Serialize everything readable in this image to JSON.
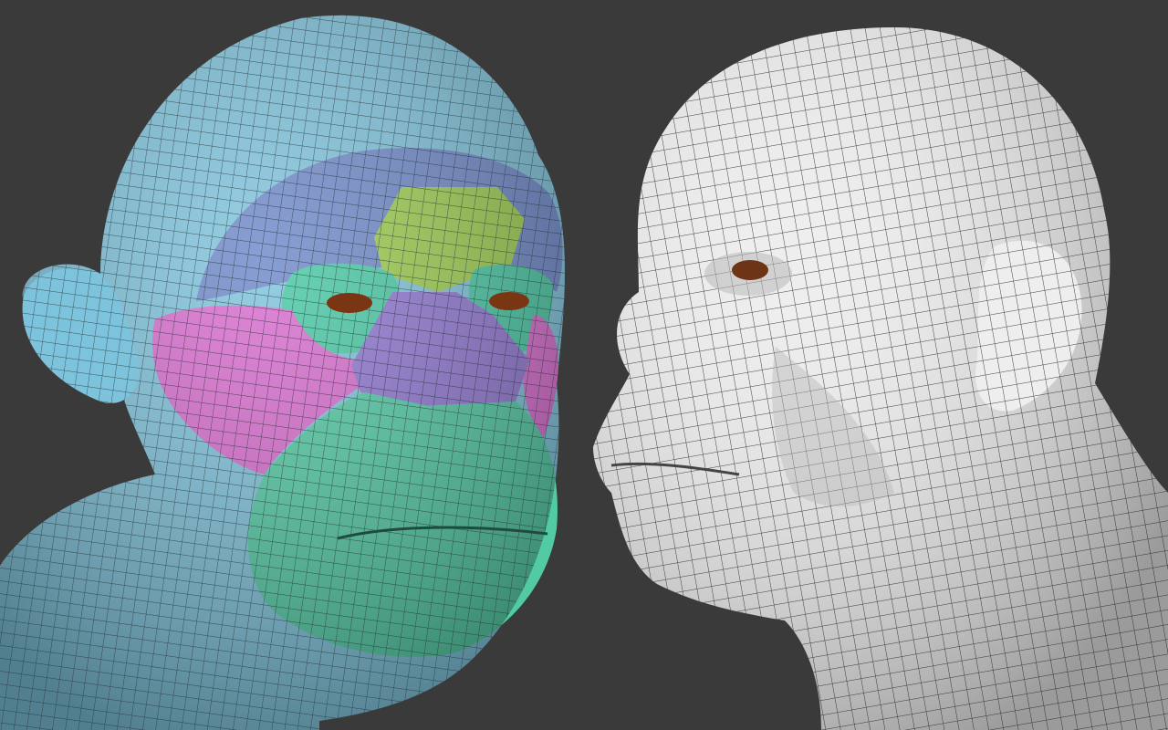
{
  "scene": {
    "background": "#3a3a3a",
    "wire": "#1d2a30"
  },
  "left_head": {
    "regions": [
      {
        "name": "skin",
        "color": "#7ec3dc"
      },
      {
        "name": "forehead-band",
        "color": "#6e88c8"
      },
      {
        "name": "glabella",
        "color": "#9ccc4e"
      },
      {
        "name": "eye-socket",
        "color": "#48c9a4"
      },
      {
        "name": "cheek",
        "color": "#d96ccf"
      },
      {
        "name": "nose",
        "color": "#8f76d2"
      },
      {
        "name": "muzzle",
        "color": "#52cba4"
      }
    ],
    "eye_color": "#7a3612"
  },
  "right_head": {
    "color": "#eeeeee",
    "shade": "#b9b9b9",
    "eye_color": "#6e3416"
  }
}
